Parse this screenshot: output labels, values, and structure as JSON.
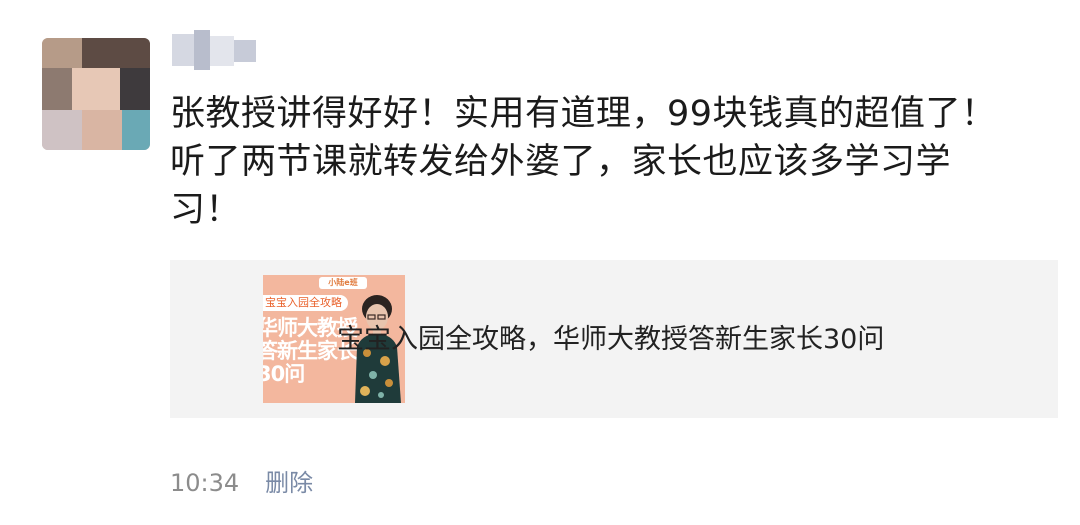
{
  "post": {
    "content": "张教授讲得好好！实用有道理，99块钱真的超值了！\n听了两节课就转发给外婆了，家长也应该多学习学\n习！",
    "shared_card": {
      "thumbnail": {
        "logo_text": "小陆e班",
        "pill_text": "宝宝入园全攻略",
        "title_text": "华师大教授\n答新生家长\n30问"
      },
      "title": "宝宝入园全攻略，华师大教授答新生家长30问"
    },
    "time": "10:34",
    "delete_label": "删除"
  },
  "colors": {
    "text": "#1b1b1b",
    "card_background": "#f3f3f3",
    "meta_gray": "#8c8c8c",
    "thumbnail_orange": "#f3b79e"
  }
}
